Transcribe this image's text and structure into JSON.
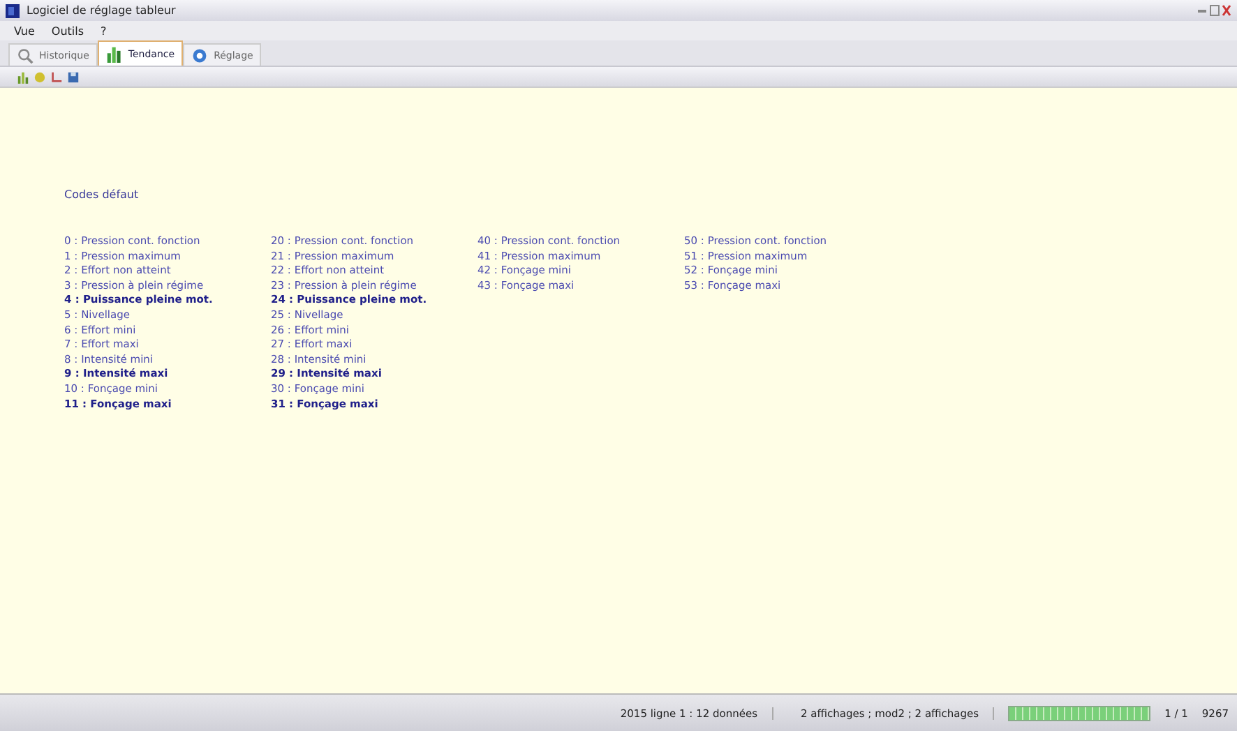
{
  "window": {
    "title": "Logiciel de réglage tableur"
  },
  "menu": [
    "Vue",
    "Outils",
    "?"
  ],
  "tabs": [
    {
      "label": "Historique",
      "selected": false
    },
    {
      "label": "Tendance",
      "selected": true
    },
    {
      "label": "Réglage",
      "selected": false
    }
  ],
  "content": {
    "heading": "Codes défaut",
    "columns": [
      [
        {
          "text": "0 : Pression cont. fonction",
          "highlighted": false
        },
        {
          "text": "1 : Pression maximum",
          "highlighted": false
        },
        {
          "text": "2 : Effort non atteint",
          "highlighted": false
        },
        {
          "text": "3 : Pression à plein régime",
          "highlighted": false
        },
        {
          "text": "4 : Puissance pleine mot.",
          "highlighted": true
        },
        {
          "text": "5 : Nivellage",
          "highlighted": false
        },
        {
          "text": "6 : Effort mini",
          "highlighted": false
        },
        {
          "text": "7 : Effort maxi",
          "highlighted": false
        },
        {
          "text": "8 : Intensité mini",
          "highlighted": false
        },
        {
          "text": "9 : Intensité maxi",
          "highlighted": true
        },
        {
          "text": "10 : Fonçage mini",
          "highlighted": false
        },
        {
          "text": "11 : Fonçage maxi",
          "highlighted": true
        }
      ],
      [
        {
          "text": "20 : Pression cont. fonction",
          "highlighted": false
        },
        {
          "text": "21 : Pression maximum",
          "highlighted": false
        },
        {
          "text": "22 : Effort non atteint",
          "highlighted": false
        },
        {
          "text": "23 : Pression à plein régime",
          "highlighted": false
        },
        {
          "text": "24 : Puissance pleine mot.",
          "highlighted": true
        },
        {
          "text": "25 : Nivellage",
          "highlighted": false
        },
        {
          "text": "26 : Effort mini",
          "highlighted": false
        },
        {
          "text": "27 : Effort maxi",
          "highlighted": false
        },
        {
          "text": "28 : Intensité mini",
          "highlighted": false
        },
        {
          "text": "29 : Intensité maxi",
          "highlighted": true
        },
        {
          "text": "30 : Fonçage mini",
          "highlighted": false
        },
        {
          "text": "31 : Fonçage maxi",
          "highlighted": true
        }
      ],
      [
        {
          "text": "40 : Pression cont. fonction",
          "highlighted": false
        },
        {
          "text": "41 : Pression maximum",
          "highlighted": false
        },
        {
          "text": "42 : Fonçage mini",
          "highlighted": false
        },
        {
          "text": "43 : Fonçage maxi",
          "highlighted": false
        }
      ],
      [
        {
          "text": "50 : Pression cont. fonction",
          "highlighted": false
        },
        {
          "text": "51 : Pression maximum",
          "highlighted": false
        },
        {
          "text": "52 : Fonçage mini",
          "highlighted": false
        },
        {
          "text": "53 : Fonçage maxi",
          "highlighted": false
        }
      ]
    ]
  },
  "status_bar": {
    "records": "2015 ligne 1 : 12 données",
    "display": "2 affichages ; mod2 ; 2 affichages",
    "progress": {
      "level": 1.0
    },
    "page": "1 / 1",
    "code": "9267"
  }
}
